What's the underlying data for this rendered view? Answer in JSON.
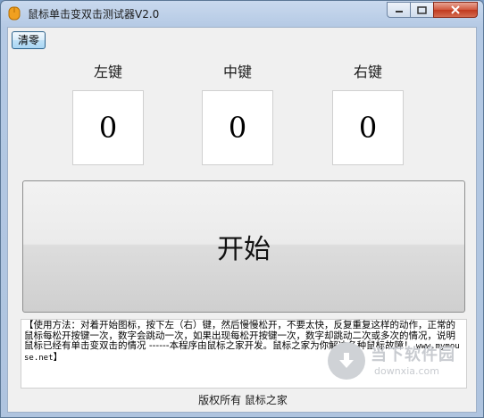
{
  "window": {
    "title": "鼠标单击变双击测试器V2.0",
    "controls": {
      "minimize": "minimize",
      "maximize": "maximize",
      "close": "close"
    }
  },
  "toolbar": {
    "clear_label": "清零"
  },
  "buttons": [
    {
      "label": "左键",
      "count": "0"
    },
    {
      "label": "中键",
      "count": "0"
    },
    {
      "label": "右键",
      "count": "0"
    }
  ],
  "start_label": "开始",
  "instructions": {
    "text": "【使用方法：对着开始图标，按下左（右）键，然后慢慢松开，不要太快，反复重复这样的动作，正常的鼠标每松开按键一次，数字会跳动一次，如果出现每松开按键一次，数字却跳动二次或多次的情况，说明鼠标已经有单击变双击的情况 ------本程序由鼠标之家开发。鼠标之家为你解决各种鼠标故障！",
    "url": "www.mymouse.net",
    "end": "】"
  },
  "footer": "版权所有 鼠标之家",
  "watermark": {
    "name": "当下软件园",
    "site": "downxia.com"
  },
  "colors": {
    "accent": "#2c628b",
    "close": "#c0391e"
  }
}
